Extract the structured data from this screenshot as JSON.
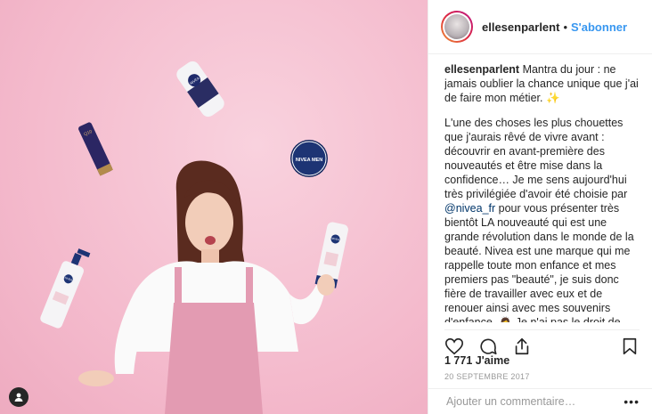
{
  "header": {
    "username": "ellesenparlent",
    "separator": "•",
    "follow_label": "S'abonner"
  },
  "caption": {
    "username": "ellesenparlent",
    "p1": "Mantra du jour : ne jamais oublier la chance unique que j'ai de faire mon métier. ✨",
    "p2_a": "L'une des choses les plus chouettes que j'aurais rêvé de vivre avant : découvrir en avant-première des nouveautés et être mise dans la confidence… Je me sens aujourd'hui très privilégiée d'avoir été choisie par ",
    "mention": "@nivea_fr",
    "p2_b": " pour vous présenter très bientôt LA nouveauté qui est une grande révolution dans le monde de la beauté. Nivea est une marque qui me rappelle toute mon enfance et mes premiers pas \"beauté\", je suis donc fière de travailler avec eux et de renouer ainsi avec mes souvenirs d'enfance. 🙇‍♀️ Je n'ai pas le droit de vous en dire plus pour le moment mais je voulais partager ma joie avec vous. Alors, je repars jongler avec mes petits produits et j'ai hâte de vous en dire davantage ! & vous, Nivea, ça vous parle ou"
  },
  "photo": {
    "products": [
      {
        "label": "NIVEA"
      },
      {
        "label": "Q10"
      },
      {
        "label": "NIVEA MEN"
      },
      {
        "label": "NIVEA"
      },
      {
        "label": "NIVEA"
      }
    ]
  },
  "actions": {
    "likes": "1 771 J'aime",
    "date": "20 SEPTEMBRE 2017"
  },
  "comment": {
    "placeholder": "Ajouter un commentaire…",
    "more": "•••"
  },
  "colors": {
    "follow_blue": "#3897f0",
    "wall_pink": "#f6c3d3",
    "dress_pink": "#e39bb2"
  },
  "icons": [
    "heart-icon",
    "comment-icon",
    "share-icon",
    "bookmark-icon",
    "user-tag-icon",
    "more-options-icon"
  ]
}
